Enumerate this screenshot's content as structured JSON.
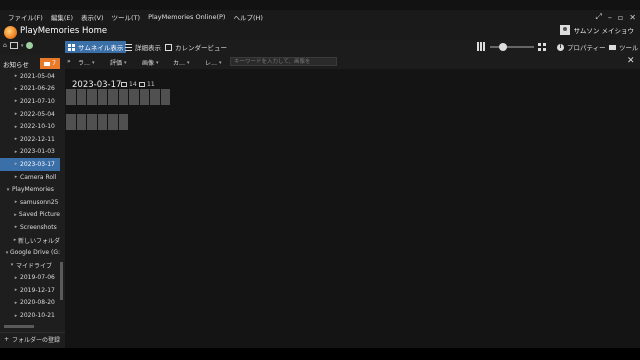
{
  "menu": [
    "ファイル(F)",
    "編集(E)",
    "表示(V)",
    "ツール(T)",
    "PlayMemories Online(P)",
    "ヘルプ(H)"
  ],
  "window_controls": [
    "⤢",
    "–",
    "▫",
    "✕"
  ],
  "app": {
    "title": "PlayMemories Home"
  },
  "user": {
    "name": "サムソン メイショウ"
  },
  "views": [
    {
      "label": "サムネイル表示",
      "icon": "thumbnail-grid-icon",
      "active": true
    },
    {
      "label": "詳細表示",
      "icon": "list-icon",
      "active": false
    },
    {
      "label": "カレンダービュー",
      "icon": "calendar-icon",
      "active": false
    }
  ],
  "toolbar": {
    "properties_label": "プロパティー",
    "tools_label": "ツール",
    "zoom_level": 0.25
  },
  "notice": {
    "label": "お知らせ",
    "count": "7"
  },
  "sidebar": {
    "items": [
      {
        "label": "2021-05-04",
        "bullet": "▸"
      },
      {
        "label": "2021-06-26",
        "bullet": "▸"
      },
      {
        "label": "2021-07-10",
        "bullet": "▸"
      },
      {
        "label": "2022-05-04",
        "bullet": "▸"
      },
      {
        "label": "2022-10-10",
        "bullet": "▸"
      },
      {
        "label": "2022-12-11",
        "bullet": "▸"
      },
      {
        "label": "2023-01-03",
        "bullet": "▸"
      },
      {
        "label": "2023-03-17",
        "bullet": "▸",
        "selected": true
      },
      {
        "label": "Camera Roll",
        "bullet": "▸"
      },
      {
        "label": "PlayMemories",
        "bullet": "▾"
      },
      {
        "label": "samusonn25",
        "bullet": "▸"
      },
      {
        "label": "Saved Picture",
        "bullet": "▸"
      },
      {
        "label": "Screenshots",
        "bullet": "▸"
      },
      {
        "label": "新しいフォルダ",
        "bullet": "▸"
      },
      {
        "label": "Google Drive (G:",
        "bullet": "▾"
      },
      {
        "label": "マイドライブ",
        "bullet": "▾"
      },
      {
        "label": "2019-07-06",
        "bullet": "▸"
      },
      {
        "label": "2019-12-17",
        "bullet": "▸"
      },
      {
        "label": "2020-08-20",
        "bullet": "▸"
      },
      {
        "label": "2020-10-21",
        "bullet": "▸"
      }
    ],
    "add_folder_label": "フォルダーの登録"
  },
  "filters": [
    {
      "label": "ラ…"
    },
    {
      "label": "評価"
    },
    {
      "label": "画像"
    },
    {
      "label": "カ…"
    },
    {
      "label": "レ…"
    }
  ],
  "search": {
    "placeholder": "キーワードを入力して、画像を"
  },
  "content": {
    "date": "2023-03-17",
    "photo_count": "14",
    "video_count": "11",
    "row1_count": 10,
    "row2_count": 6
  }
}
